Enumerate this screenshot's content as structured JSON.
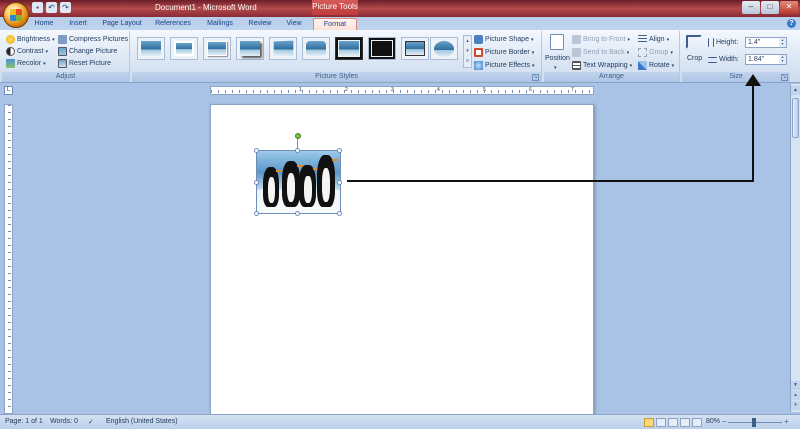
{
  "titlebar": {
    "document_title": "Document1 - Microsoft Word",
    "context_title": "Picture Tools",
    "window_buttons": [
      "–",
      "□",
      "✕"
    ]
  },
  "tabs": [
    "Home",
    "Insert",
    "Page Layout",
    "References",
    "Mailings",
    "Review",
    "View",
    "Format"
  ],
  "active_tab": "Format",
  "ribbon": {
    "adjust": {
      "label": "Adjust",
      "brightness": "Brightness",
      "contrast": "Contrast",
      "recolor": "Recolor",
      "compress": "Compress Pictures",
      "change": "Change Picture",
      "reset": "Reset Picture"
    },
    "styles": {
      "label": "Picture Styles",
      "shape": "Picture Shape",
      "border": "Picture Border",
      "effects": "Picture Effects"
    },
    "arrange": {
      "label": "Arrange",
      "position": "Position",
      "bring_front": "Bring to Front",
      "send_back": "Send to Back",
      "text_wrapping": "Text Wrapping",
      "align": "Align",
      "group": "Group",
      "rotate": "Rotate"
    },
    "size": {
      "label": "Size",
      "crop": "Crop",
      "height_label": "Height:",
      "height_value": "1.4\"",
      "width_label": "Width:",
      "width_value": "1.84\""
    }
  },
  "ruler": {
    "numbers": [
      "1",
      "2",
      "3",
      "4",
      "5",
      "6",
      "7"
    ]
  },
  "status": {
    "page": "Page: 1 of 1",
    "words": "Words: 0",
    "language": "English (United States)",
    "zoom": "80%"
  }
}
